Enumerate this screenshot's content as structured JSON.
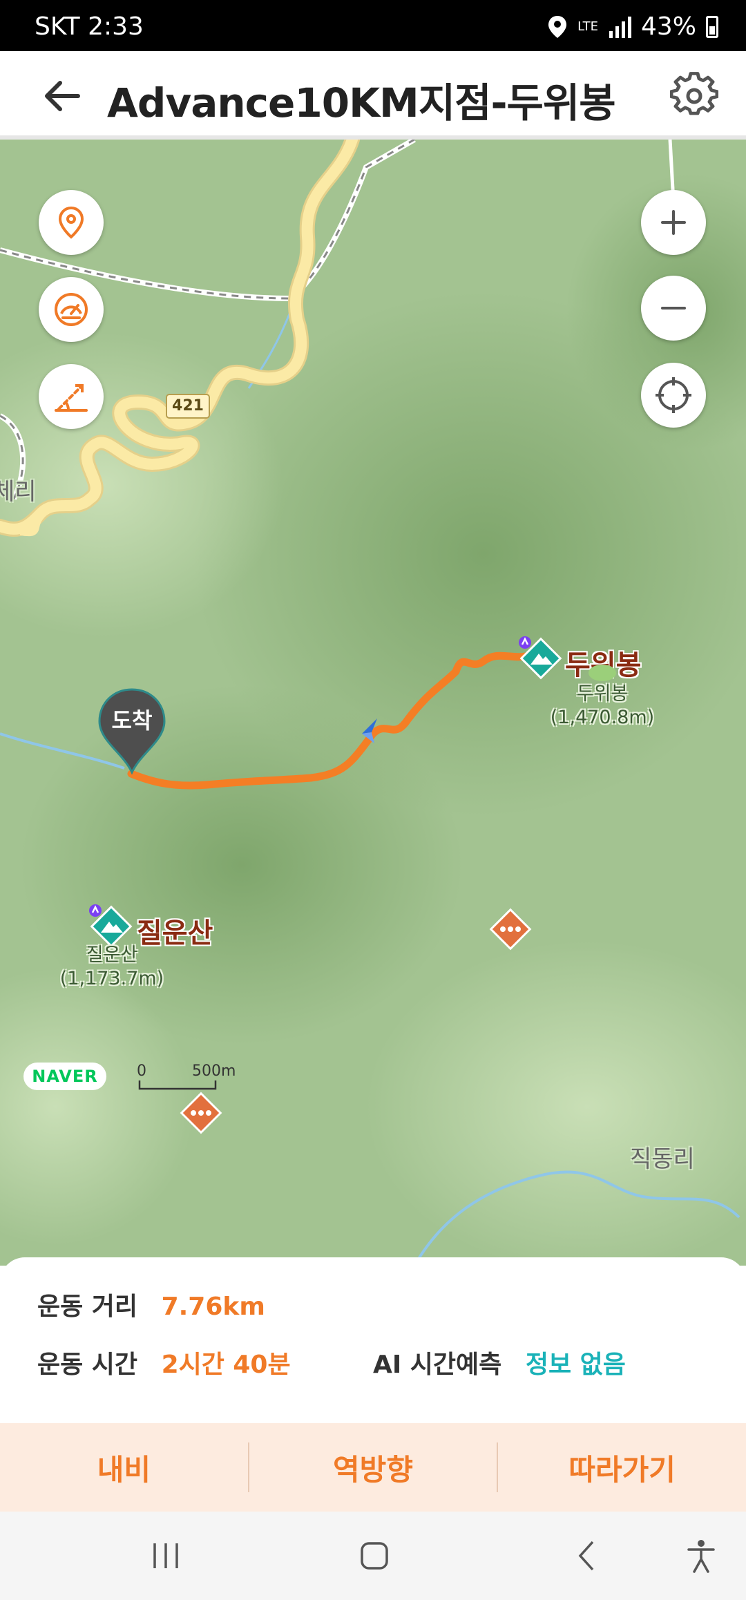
{
  "status_bar": {
    "carrier_time": "SKT 2:33",
    "network": "LTE",
    "battery": "43%"
  },
  "header": {
    "title": "Advance10KM지점-두위봉",
    "back_icon": "arrow-left-icon",
    "settings_icon": "gear-icon"
  },
  "map": {
    "left_controls": [
      "location-pin-icon",
      "speedometer-icon",
      "slope-angle-icon"
    ],
    "right_controls": [
      "plus-icon",
      "minus-icon",
      "crosshair-icon"
    ],
    "road_number": "421",
    "arrival_label": "도착",
    "peaks": [
      {
        "name": "두위봉",
        "sub": "두위봉",
        "elevation": "(1,470.8m)"
      },
      {
        "name": "질운산",
        "sub": "질운산",
        "elevation": "(1,173.7m)"
      }
    ],
    "place_labels": [
      "체리",
      "직동리"
    ],
    "provider": "NAVER",
    "scale": {
      "start": "0",
      "end": "500m"
    }
  },
  "info": {
    "distance_label": "운동 거리",
    "distance_value": "7.76km",
    "time_label": "운동 시간",
    "time_value": "2시간 40분",
    "ai_label": "AI 시간예측",
    "ai_value": "정보 없음"
  },
  "actions": {
    "navi": "내비",
    "reverse": "역방향",
    "follow": "따라가기"
  },
  "colors": {
    "accent": "#f07a27",
    "teal": "#1ab2b8",
    "map_green": "#9fc08b"
  }
}
